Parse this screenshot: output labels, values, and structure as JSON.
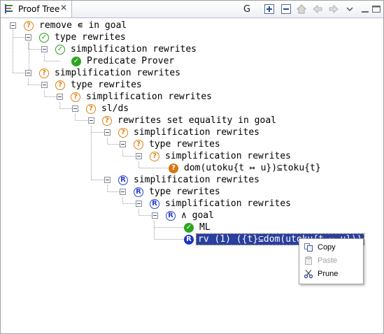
{
  "tab": {
    "title": "Proof Tree",
    "close": "✕"
  },
  "toolbar": {
    "goal_label": "G"
  },
  "tree": {
    "rows": [
      {
        "text": "remove ∊ in goal"
      },
      {
        "text": "type rewrites"
      },
      {
        "text": "simplification rewrites"
      },
      {
        "text": "Predicate Prover"
      },
      {
        "text": "simplification rewrites"
      },
      {
        "text": "type rewrites"
      },
      {
        "text": "simplification rewrites"
      },
      {
        "text": "sl/ds"
      },
      {
        "text": "rewrites set equality in goal"
      },
      {
        "text": "simplification rewrites"
      },
      {
        "text": "type rewrites"
      },
      {
        "text": "simplification rewrites"
      },
      {
        "text": "dom(utoku{t ↦ u})⊆toku{t}"
      },
      {
        "text": "simplification rewrites"
      },
      {
        "text": "type rewrites"
      },
      {
        "text": "simplification rewrites"
      },
      {
        "text": "∧ goal"
      },
      {
        "text": "ML"
      },
      {
        "text": "rv (1) ({t}⊆dom(utoku{t ↦ u}))"
      }
    ]
  },
  "context_menu": {
    "items": [
      {
        "label": "Copy",
        "enabled": true
      },
      {
        "label": "Paste",
        "enabled": false
      },
      {
        "label": "Prune",
        "enabled": true
      }
    ]
  },
  "colors": {
    "selection": "#2a3f9e",
    "pending": "#e08010",
    "discharged": "#2e9b22",
    "reviewed": "#2a43c8"
  }
}
